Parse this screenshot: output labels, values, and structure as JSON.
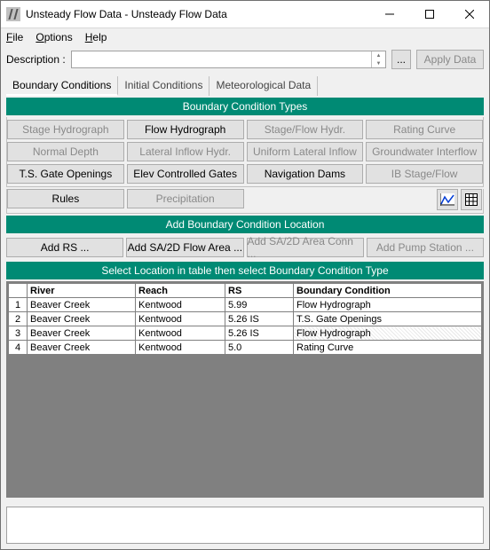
{
  "window": {
    "title": "Unsteady Flow Data - Unsteady Flow Data"
  },
  "menu": {
    "file": "File",
    "options": "Options",
    "help": "Help"
  },
  "description": {
    "label": "Description :",
    "value": "",
    "browse": "...",
    "apply": "Apply Data"
  },
  "tabs": {
    "boundary": "Boundary Conditions",
    "initial": "Initial Conditions",
    "meteo": "Meteorological Data"
  },
  "bc_header": "Boundary Condition Types",
  "bc_buttons": [
    {
      "label": "Stage Hydrograph",
      "enabled": false
    },
    {
      "label": "Flow Hydrograph",
      "enabled": true
    },
    {
      "label": "Stage/Flow Hydr.",
      "enabled": false
    },
    {
      "label": "Rating Curve",
      "enabled": false
    },
    {
      "label": "Normal Depth",
      "enabled": false
    },
    {
      "label": "Lateral Inflow Hydr.",
      "enabled": false
    },
    {
      "label": "Uniform Lateral Inflow",
      "enabled": false
    },
    {
      "label": "Groundwater Interflow",
      "enabled": false
    },
    {
      "label": "T.S. Gate Openings",
      "enabled": true
    },
    {
      "label": "Elev Controlled Gates",
      "enabled": true
    },
    {
      "label": "Navigation Dams",
      "enabled": true
    },
    {
      "label": "IB Stage/Flow",
      "enabled": false
    }
  ],
  "rules_btn": "Rules",
  "precip_btn": "Precipitation",
  "add_bc_header": "Add Boundary Condition Location",
  "add_buttons": {
    "rs": "Add RS ...",
    "sa2d": "Add SA/2D Flow Area ...",
    "conn": "Add SA/2D Area Conn ...",
    "pump": "Add Pump Station ..."
  },
  "table_header": "Select Location in table then select Boundary Condition Type",
  "columns": {
    "river": "River",
    "reach": "Reach",
    "rs": "RS",
    "bc": "Boundary Condition"
  },
  "rows": [
    {
      "n": "1",
      "river": "Beaver Creek",
      "reach": "Kentwood",
      "rs": "5.99",
      "bc": "Flow Hydrograph",
      "sel": false
    },
    {
      "n": "2",
      "river": "Beaver Creek",
      "reach": "Kentwood",
      "rs": "5.26    IS",
      "bc": "T.S. Gate Openings",
      "sel": false
    },
    {
      "n": "3",
      "river": "Beaver Creek",
      "reach": "Kentwood",
      "rs": "5.26    IS",
      "bc": "Flow Hydrograph",
      "sel": true
    },
    {
      "n": "4",
      "river": "Beaver Creek",
      "reach": "Kentwood",
      "rs": "5.0",
      "bc": "Rating Curve",
      "sel": false
    }
  ]
}
